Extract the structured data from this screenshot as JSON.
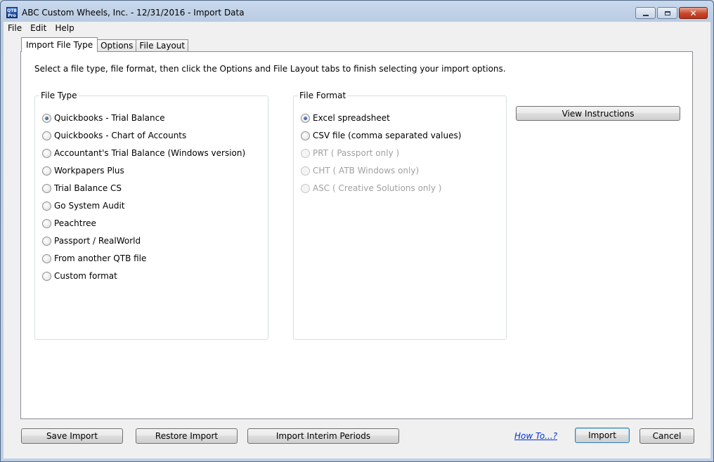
{
  "window": {
    "icon_text": "QTB Pro",
    "title": "ABC Custom Wheels, Inc. - 12/31/2016 - Import Data",
    "minimize": "—",
    "restore": "▢",
    "close": "✕"
  },
  "menu": [
    "File",
    "Edit",
    "Help"
  ],
  "tabs": [
    "Import File Type",
    "Options",
    "File Layout"
  ],
  "instructions": "Select a file type, file format, then click the Options and File Layout tabs to finish selecting your import options.",
  "file_type": {
    "title": "File Type",
    "options": [
      {
        "label": "Quickbooks - Trial Balance",
        "checked": true
      },
      {
        "label": "Quickbooks - Chart of Accounts",
        "checked": false
      },
      {
        "label": "Accountant's Trial Balance (Windows version)",
        "checked": false
      },
      {
        "label": "Workpapers Plus",
        "checked": false
      },
      {
        "label": "Trial Balance CS",
        "checked": false
      },
      {
        "label": "Go System Audit",
        "checked": false
      },
      {
        "label": "Peachtree",
        "checked": false
      },
      {
        "label": "Passport / RealWorld",
        "checked": false
      },
      {
        "label": "From another QTB file",
        "checked": false
      },
      {
        "label": "Custom format",
        "checked": false
      }
    ]
  },
  "file_format": {
    "title": "File Format",
    "options": [
      {
        "label": "Excel spreadsheet",
        "checked": true,
        "disabled": false
      },
      {
        "label": "CSV file (comma separated values)",
        "checked": false,
        "disabled": false
      },
      {
        "label": "PRT ( Passport only )",
        "checked": false,
        "disabled": true
      },
      {
        "label": "CHT ( ATB Windows only)",
        "checked": false,
        "disabled": true
      },
      {
        "label": "ASC ( Creative Solutions only )",
        "checked": false,
        "disabled": true
      }
    ]
  },
  "view_instructions": "View Instructions",
  "footer": {
    "save_import": "Save Import",
    "restore_import": "Restore Import",
    "import_interim": "Import Interim Periods",
    "how_to": "How To...?",
    "import": "Import",
    "cancel": "Cancel"
  }
}
